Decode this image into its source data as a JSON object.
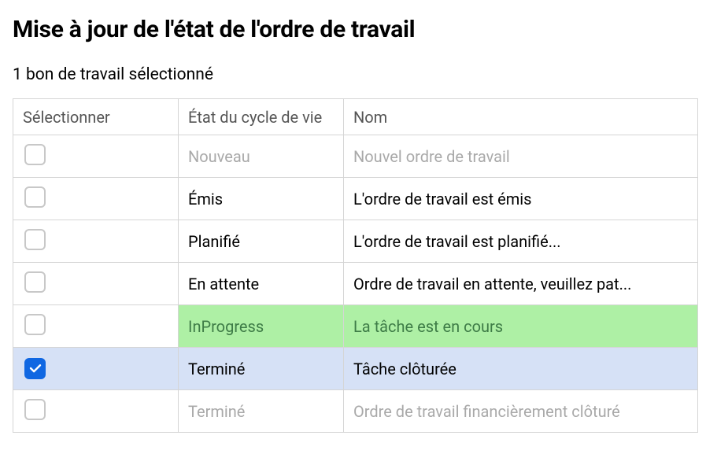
{
  "page": {
    "title": "Mise à jour de l'état de l'ordre de travail",
    "subtitle": "1 bon de travail sélectionné"
  },
  "table": {
    "headers": {
      "select": "Sélectionner",
      "state": "État du cycle de vie",
      "name": "Nom"
    },
    "rows": [
      {
        "state": "Nouveau",
        "name": "Nouvel ordre de travail",
        "checked": false,
        "style": "disabled"
      },
      {
        "state": "Émis",
        "name": "L'ordre de travail est émis",
        "checked": false,
        "style": ""
      },
      {
        "state": "Planifié",
        "name": "L'ordre de travail est planifié...",
        "checked": false,
        "style": ""
      },
      {
        "state": "En attente",
        "name": "Ordre de travail en attente, veuillez pat...",
        "checked": false,
        "style": ""
      },
      {
        "state": "InProgress",
        "name": "La tâche est en cours",
        "checked": false,
        "style": "highlight-green"
      },
      {
        "state": "Terminé",
        "name": "Tâche clôturée",
        "checked": true,
        "style": "highlight-blue"
      },
      {
        "state": "Terminé",
        "name": "Ordre de travail financièrement clôturé",
        "checked": false,
        "style": "disabled"
      }
    ]
  }
}
